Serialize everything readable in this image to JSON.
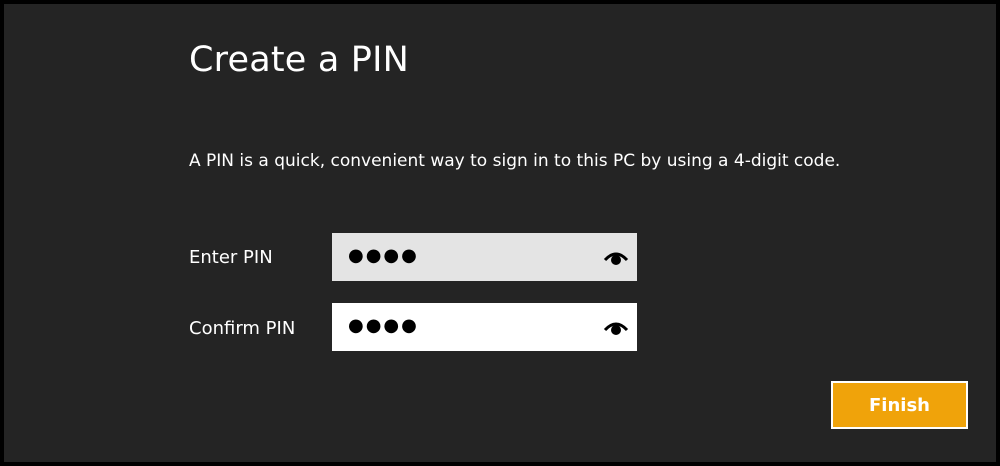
{
  "dialog": {
    "title": "Create a PIN",
    "description": "A PIN is a quick, convenient way to sign in to this PC by using a 4-digit code."
  },
  "fields": {
    "enter": {
      "label": "Enter PIN",
      "masked_value": "●●●●",
      "icon": "eye-icon"
    },
    "confirm": {
      "label": "Confirm PIN",
      "masked_value": "●●●●",
      "icon": "eye-icon"
    }
  },
  "actions": {
    "finish_label": "Finish"
  },
  "colors": {
    "background": "#242424",
    "accent": "#f0a30a",
    "field_inactive": "#e4e4e4",
    "field_active": "#ffffff",
    "text": "#ffffff"
  }
}
